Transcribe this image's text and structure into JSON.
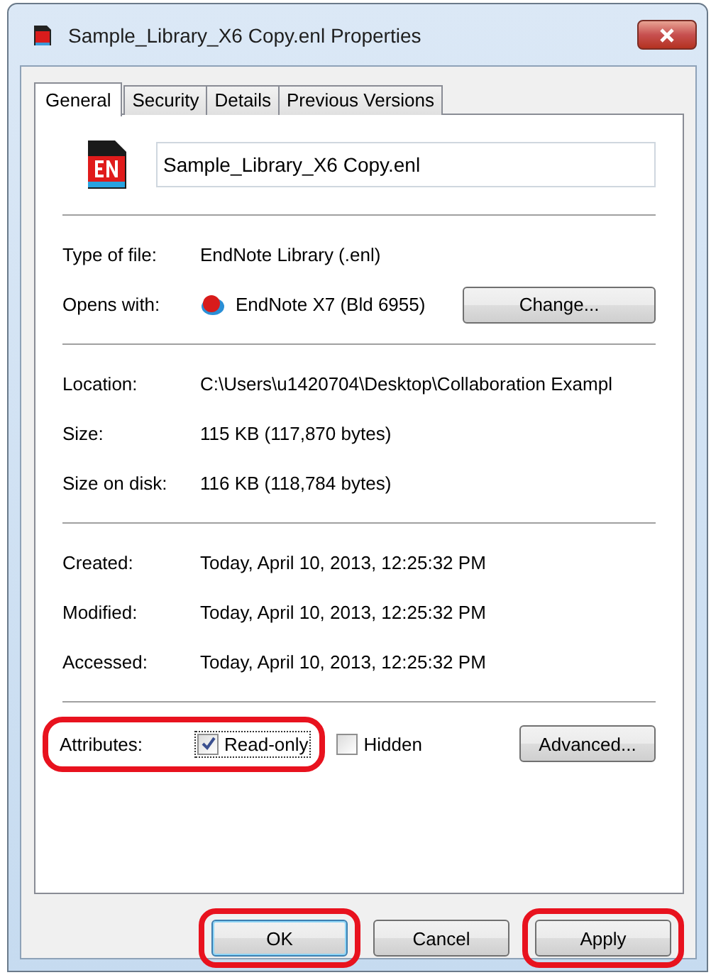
{
  "window": {
    "title": "Sample_Library_X6 Copy.enl Properties"
  },
  "tabs": [
    {
      "label": "General",
      "selected": true
    },
    {
      "label": "Security",
      "selected": false
    },
    {
      "label": "Details",
      "selected": false
    },
    {
      "label": "Previous Versions",
      "selected": false
    }
  ],
  "file_name": {
    "value": "Sample_Library_X6 Copy.enl"
  },
  "sections": [
    {
      "rows": [
        {
          "kind": "text",
          "label": "Type of file:",
          "value": "EndNote Library (.enl)"
        },
        {
          "kind": "app",
          "label": "Opens with:",
          "value": "EndNote X7 (Bld 6955)",
          "button": "Change..."
        }
      ]
    },
    {
      "rows": [
        {
          "kind": "text",
          "label": "Location:",
          "value": "C:\\Users\\u1420704\\Desktop\\Collaboration Exampl"
        },
        {
          "kind": "text",
          "label": "Size:",
          "value": "115 KB (117,870 bytes)"
        },
        {
          "kind": "text",
          "label": "Size on disk:",
          "value": "116 KB (118,784 bytes)"
        }
      ]
    },
    {
      "rows": [
        {
          "kind": "text",
          "label": "Created:",
          "value": "Today, April 10, 2013, 12:25:32 PM"
        },
        {
          "kind": "text",
          "label": "Modified:",
          "value": "Today, April 10, 2013, 12:25:32 PM"
        },
        {
          "kind": "text",
          "label": "Accessed:",
          "value": "Today, April 10, 2013, 12:25:32 PM"
        }
      ]
    }
  ],
  "attributes": {
    "label": "Attributes:",
    "highlighted": true,
    "checkboxes": [
      {
        "label": "Read-only",
        "checked": true,
        "focused": true
      },
      {
        "label": "Hidden",
        "checked": false,
        "focused": false
      }
    ],
    "button": "Advanced..."
  },
  "buttons": [
    {
      "label": "OK",
      "default": true,
      "highlighted": true
    },
    {
      "label": "Cancel",
      "default": false,
      "highlighted": false
    },
    {
      "label": "Apply",
      "default": false,
      "highlighted": true
    }
  ]
}
